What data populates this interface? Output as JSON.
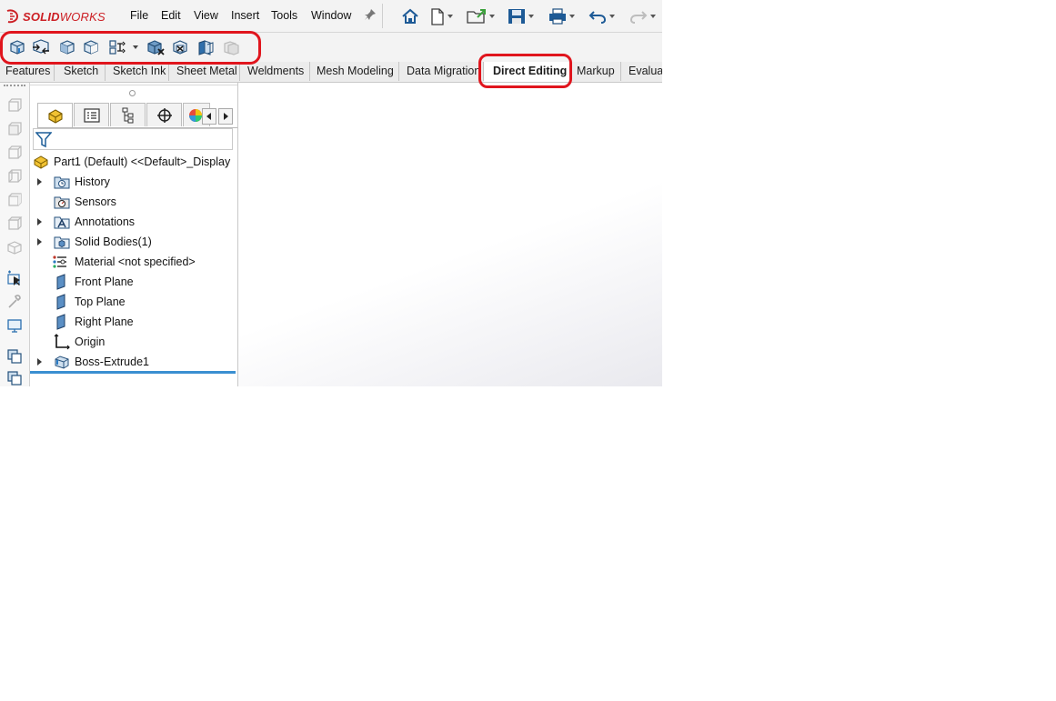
{
  "brand": {
    "solid": "SOLID",
    "works": "WORKS",
    "accent": "#cc1f24"
  },
  "menu": [
    "File",
    "Edit",
    "View",
    "Insert",
    "Tools",
    "Window"
  ],
  "quick_access": [
    "home-icon",
    "new-document-icon",
    "open-icon",
    "save-icon",
    "print-icon",
    "undo-icon",
    "redo-icon"
  ],
  "command_icons": [
    "move-copy-bodies-icon",
    "replace-face-icon",
    "delete-face-icon",
    "move-face-icon",
    "split-line-icon",
    "delete-body-icon",
    "delete-hole-icon",
    "combine-icon",
    "intersect-icon"
  ],
  "tabs": [
    "Features",
    "Sketch",
    "Sketch Ink",
    "Sheet Metal",
    "Weldments",
    "Mesh Modeling",
    "Data Migration",
    "Direct Editing",
    "Markup",
    "Evaluat"
  ],
  "active_tab": "Direct Editing",
  "tree": {
    "root": "Part1 (Default) <<Default>_Display",
    "items": [
      {
        "label": "History",
        "icon": "history-folder-icon",
        "expandable": true
      },
      {
        "label": "Sensors",
        "icon": "sensors-folder-icon",
        "expandable": false
      },
      {
        "label": "Annotations",
        "icon": "annotations-folder-icon",
        "expandable": true
      },
      {
        "label": "Solid Bodies(1)",
        "icon": "solid-bodies-folder-icon",
        "expandable": true
      },
      {
        "label": "Material <not specified>",
        "icon": "material-icon",
        "expandable": false
      },
      {
        "label": "Front Plane",
        "icon": "plane-icon",
        "expandable": false
      },
      {
        "label": "Top Plane",
        "icon": "plane-icon",
        "expandable": false
      },
      {
        "label": "Right Plane",
        "icon": "plane-icon",
        "expandable": false
      },
      {
        "label": "Origin",
        "icon": "origin-icon",
        "expandable": false
      },
      {
        "label": "Boss-Extrude1",
        "icon": "boss-extrude-icon",
        "expandable": true
      }
    ]
  },
  "highlight_color": "#e0151d"
}
